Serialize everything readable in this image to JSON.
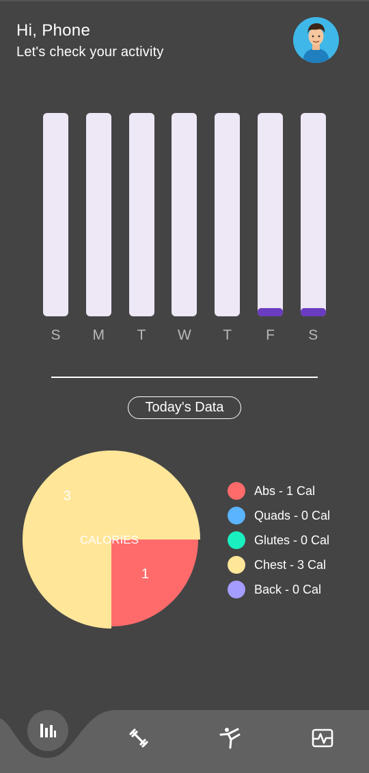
{
  "header": {
    "greeting": "Hi, Phone",
    "subtitle": "Let's check your activity"
  },
  "weekly_bars": [
    {
      "day": "S",
      "level": 0
    },
    {
      "day": "M",
      "level": 0
    },
    {
      "day": "T",
      "level": 0
    },
    {
      "day": "W",
      "level": 0
    },
    {
      "day": "T",
      "level": 0
    },
    {
      "day": "F",
      "level": 0.04
    },
    {
      "day": "S",
      "level": 0.04
    }
  ],
  "today_button": "Today's Data",
  "chart_data": {
    "type": "pie",
    "center_label": "CALORIES",
    "slices": [
      {
        "name": "Abs",
        "value": 1,
        "color": "#ff6b6b"
      },
      {
        "name": "Chest",
        "value": 3,
        "color": "#ffe699"
      }
    ],
    "slice_labels": [
      "1",
      "3"
    ]
  },
  "legend": [
    {
      "label": "Abs - 1 Cal",
      "color": "#ff6b6b"
    },
    {
      "label": "Quads - 0 Cal",
      "color": "#5ab4ff"
    },
    {
      "label": "Glutes - 0 Cal",
      "color": "#19f0c0"
    },
    {
      "label": "Chest - 3 Cal",
      "color": "#ffe699"
    },
    {
      "label": "Back - 0 Cal",
      "color": "#a59cff"
    }
  ],
  "nav": {
    "items": [
      "stats-icon",
      "dumbbell-icon",
      "stretch-icon",
      "activity-icon"
    ],
    "active": "stats-icon",
    "colors": {
      "bar_bg": "#616161",
      "page_bg": "#444444"
    }
  }
}
